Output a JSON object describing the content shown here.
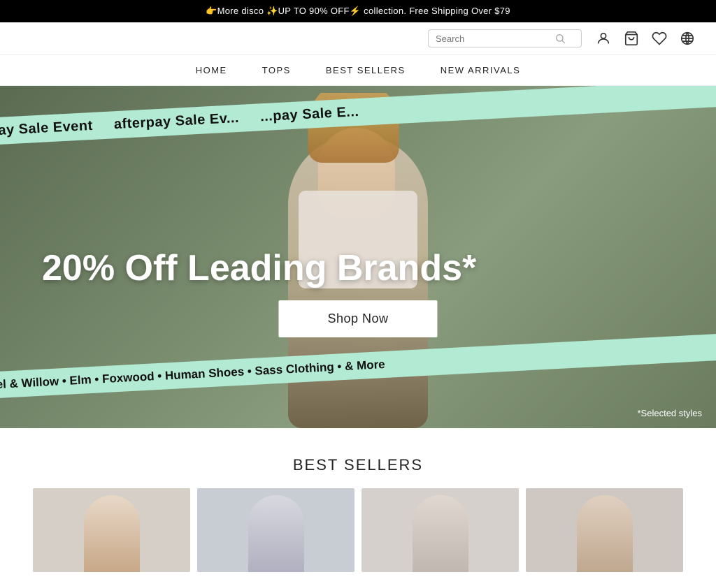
{
  "announcement": {
    "text": "👉More disco ✨UP TO 90% OFF⚡ collection.  Free Shipping Over $79"
  },
  "header": {
    "logo": "",
    "search_placeholder": "Search",
    "icons": {
      "search": "search-icon",
      "account": "account-icon",
      "cart": "cart-icon",
      "wishlist": "wishlist-icon",
      "language": "language-icon"
    }
  },
  "nav": {
    "items": [
      {
        "label": "HOME",
        "id": "home"
      },
      {
        "label": "TOPS",
        "id": "tops"
      },
      {
        "label": "BEST SELLERS",
        "id": "best-sellers"
      },
      {
        "label": "NEW ARRIVALS",
        "id": "new-arrivals"
      }
    ]
  },
  "hero": {
    "afterpay_text_top": "afterpay Sale Event   afterpay Sale Ev...   ...pay Sale E...",
    "headline": "20% Off Leading Brands*",
    "cta_label": "Shop Now",
    "brands_text": "Cartel & Willow • Elm • Foxwood • Human Shoes • Sass Clothing • & More",
    "selected_styles": "*Selected styles"
  },
  "best_sellers": {
    "title": "BEST SELLERS",
    "products": [
      {
        "id": 1
      },
      {
        "id": 2
      },
      {
        "id": 3
      },
      {
        "id": 4
      }
    ]
  }
}
